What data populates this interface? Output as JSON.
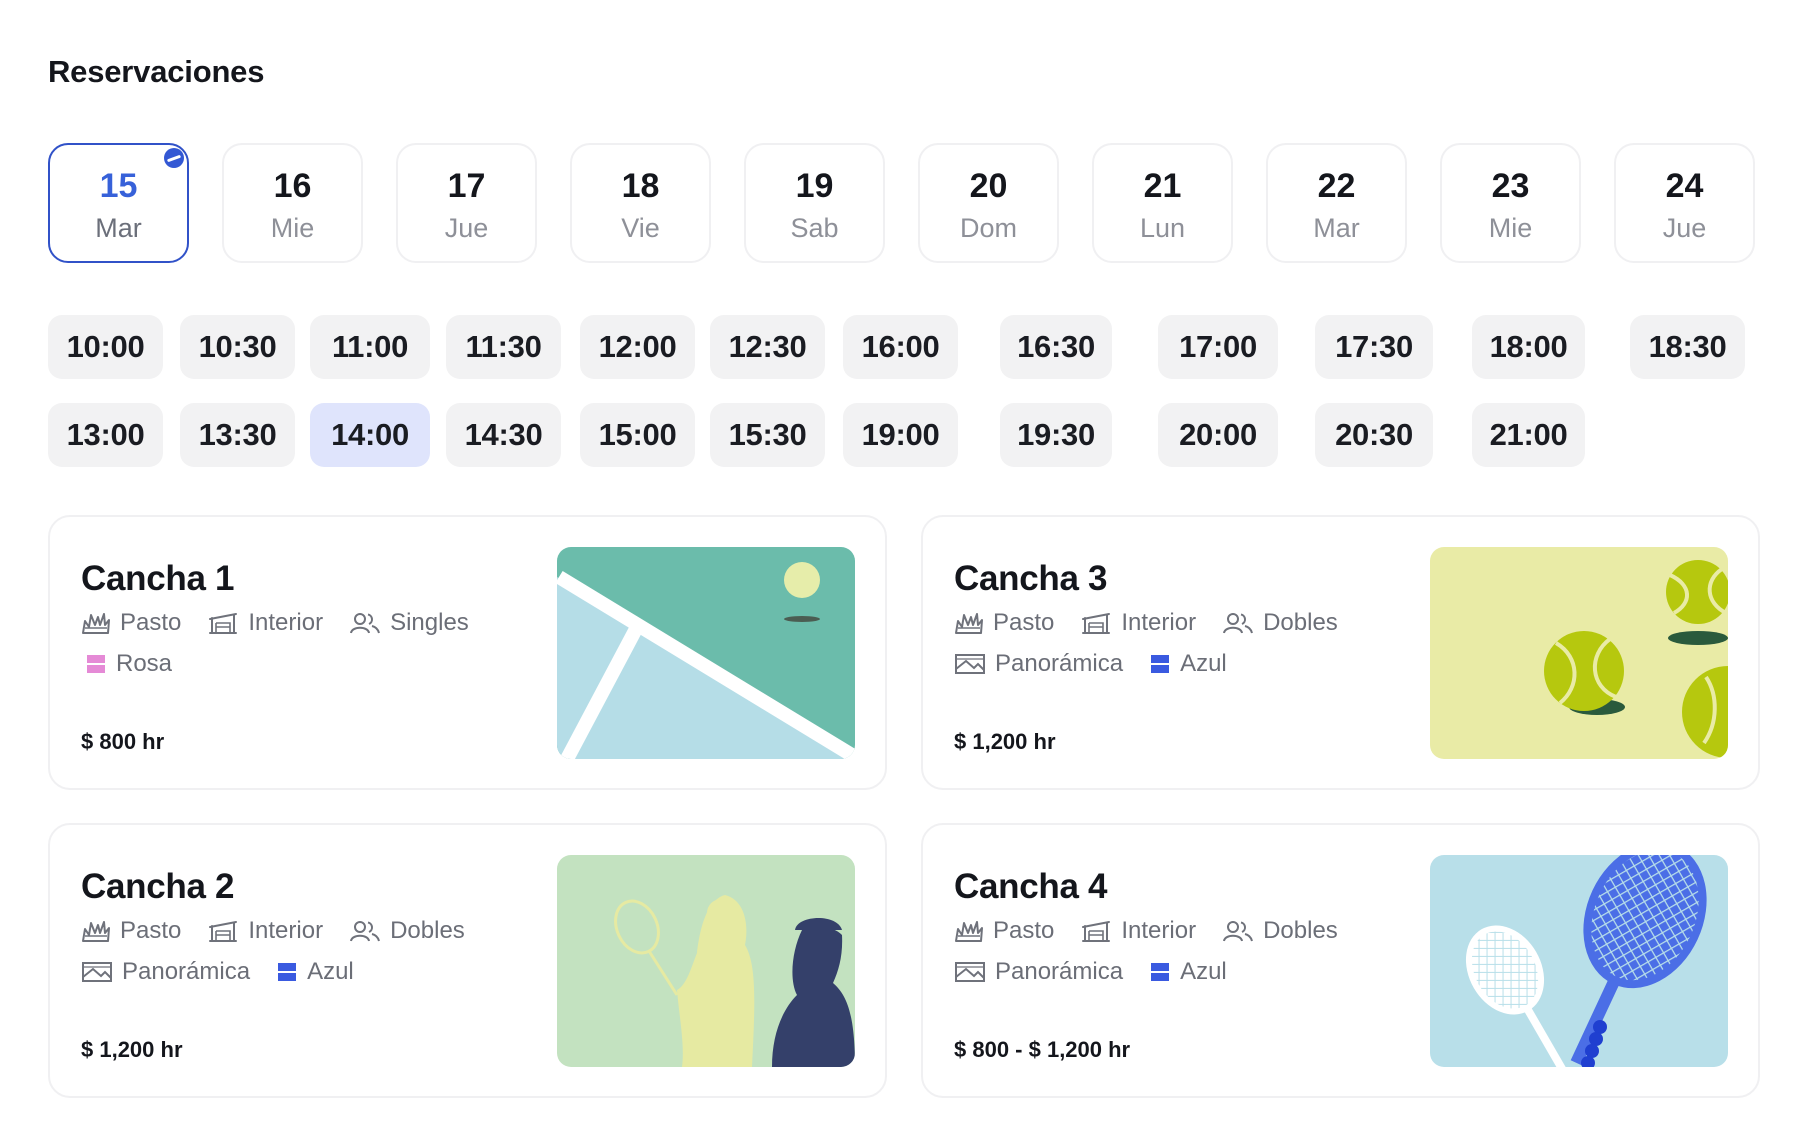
{
  "page": {
    "title": "Reservaciones"
  },
  "dates": [
    {
      "day": "15",
      "dow": "Mar",
      "active": true
    },
    {
      "day": "16",
      "dow": "Mie",
      "active": false
    },
    {
      "day": "17",
      "dow": "Jue",
      "active": false
    },
    {
      "day": "18",
      "dow": "Vie",
      "active": false
    },
    {
      "day": "19",
      "dow": "Sab",
      "active": false
    },
    {
      "day": "20",
      "dow": "Dom",
      "active": false
    },
    {
      "day": "21",
      "dow": "Lun",
      "active": false
    },
    {
      "day": "22",
      "dow": "Mar",
      "active": false
    },
    {
      "day": "23",
      "dow": "Mie",
      "active": false
    },
    {
      "day": "24",
      "dow": "Jue",
      "active": false
    }
  ],
  "times": {
    "row1": [
      "10:00",
      "10:30",
      "11:00",
      "11:30",
      "12:00",
      "12:30",
      "16:00",
      "16:30",
      "17:00",
      "17:30",
      "18:00",
      "18:30"
    ],
    "row2": [
      "13:00",
      "13:30",
      "14:00",
      "14:30",
      "15:00",
      "15:30",
      "19:00",
      "19:30",
      "20:00",
      "20:30",
      "21:00"
    ],
    "selected": "14:00"
  },
  "courts": [
    {
      "name": "Cancha 1",
      "surface": "Pasto",
      "setting": "Interior",
      "format": "Singles",
      "extra": [
        {
          "icon": "color-swatch-icon",
          "label": "Rosa",
          "color": "#e58ad6"
        }
      ],
      "price": "$ 800 hr",
      "image": "court-diagram"
    },
    {
      "name": "Cancha 2",
      "surface": "Pasto",
      "setting": "Interior",
      "format": "Dobles",
      "extra": [
        {
          "icon": "panoramic-icon",
          "label": "Panorámica"
        },
        {
          "icon": "color-swatch-icon",
          "label": "Azul",
          "color": "#3a5ae0"
        }
      ],
      "price": "$ 1,200 hr",
      "image": "players"
    },
    {
      "name": "Cancha 3",
      "surface": "Pasto",
      "setting": "Interior",
      "format": "Dobles",
      "extra": [
        {
          "icon": "panoramic-icon",
          "label": "Panorámica"
        },
        {
          "icon": "color-swatch-icon",
          "label": "Azul",
          "color": "#3a5ae0"
        }
      ],
      "price": "$ 1,200 hr",
      "image": "balls"
    },
    {
      "name": "Cancha 4",
      "surface": "Pasto",
      "setting": "Interior",
      "format": "Dobles",
      "extra": [
        {
          "icon": "panoramic-icon",
          "label": "Panorámica"
        },
        {
          "icon": "color-swatch-icon",
          "label": "Azul",
          "color": "#3a5ae0"
        }
      ],
      "price": "$ 800 - $ 1,200 hr",
      "image": "rackets"
    }
  ],
  "colors": {
    "accent": "#3761d9",
    "selected_chip": "#dfe4fc",
    "chip": "#f2f2f3"
  }
}
